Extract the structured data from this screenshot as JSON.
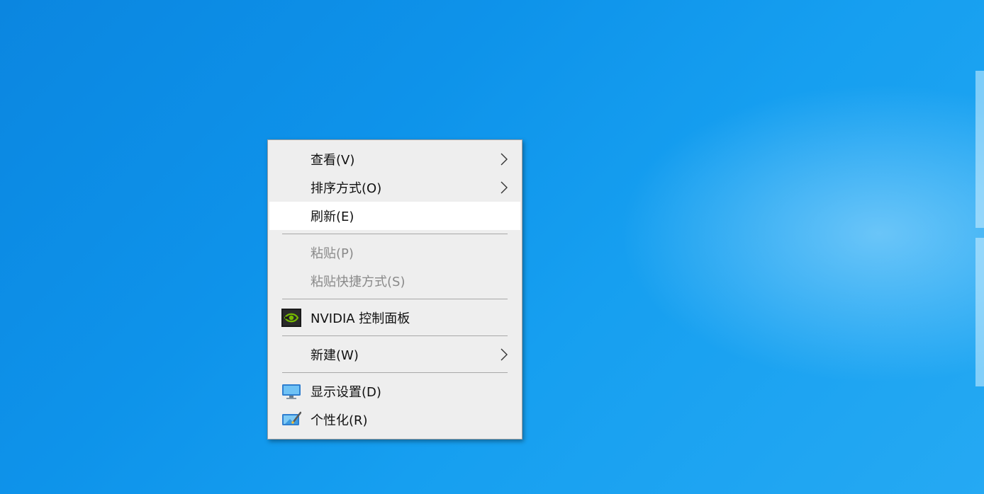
{
  "context_menu": {
    "items": [
      {
        "label": "查看(V)",
        "has_submenu": true
      },
      {
        "label": "排序方式(O)",
        "has_submenu": true
      },
      {
        "label": "刷新(E)",
        "highlighted": true
      },
      {
        "label": "粘贴(P)",
        "disabled": true
      },
      {
        "label": "粘贴快捷方式(S)",
        "disabled": true
      },
      {
        "label": "NVIDIA 控制面板",
        "icon": "nvidia-icon"
      },
      {
        "label": "新建(W)",
        "has_submenu": true
      },
      {
        "label": "显示设置(D)",
        "icon": "display-settings-icon"
      },
      {
        "label": "个性化(R)",
        "icon": "personalize-icon"
      }
    ]
  },
  "colors": {
    "desktop_background": "#0e93ea",
    "menu_background": "#eeeeee",
    "highlight": "#ffffff",
    "disabled_text": "#8a8a8a",
    "nvidia_green": "#76b900"
  }
}
